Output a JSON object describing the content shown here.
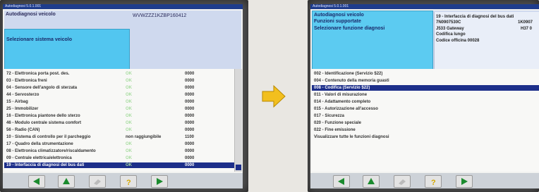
{
  "left_screen": {
    "window_title": "Autodiagnosi 5.0.1.001",
    "header_title": "Autodiagnosi veicolo",
    "vin": "WVWZZZ1KZBP160412",
    "prompt": "Selezionare sistema veicolo",
    "rows": [
      {
        "label": "72 - Elettronica porta post. des.",
        "status": "OK",
        "code": "0000"
      },
      {
        "label": "03 - Elettronica freni",
        "status": "OK",
        "code": "0000"
      },
      {
        "label": "04 - Sensore dell'angolo di sterzata",
        "status": "OK",
        "code": "0000"
      },
      {
        "label": "44 - Servosterzo",
        "status": "OK",
        "code": "0000"
      },
      {
        "label": "15 - Airbag",
        "status": "OK",
        "code": "0000"
      },
      {
        "label": "25 - Immobilizer",
        "status": "OK",
        "code": "0000"
      },
      {
        "label": "16 - Elettronica piantone dello sterzo",
        "status": "OK",
        "code": "0000"
      },
      {
        "label": "46 - Modulo centrale sistema comfort",
        "status": "OK",
        "code": "0000"
      },
      {
        "label": "56 - Radio (CAN)",
        "status": "OK",
        "code": "0000"
      },
      {
        "label": "10 - Sistema di controllo per il parcheggio",
        "status": "non raggiungibile",
        "code": "1100"
      },
      {
        "label": "17 - Quadro della strumentazione",
        "status": "OK",
        "code": "0000"
      },
      {
        "label": "08 - Elettronica climatizzatore/riscaldamento",
        "status": "OK",
        "code": "0000"
      },
      {
        "label": "09 - Centrale elettrica/elettronica",
        "status": "OK",
        "code": "0000"
      },
      {
        "label": "19 - Interfaccia di diagnosi del bus dati",
        "status": "OK",
        "code": "0000"
      }
    ],
    "selected_index": 13
  },
  "right_screen": {
    "window_title": "Autodiagnosi 5.0.1.001",
    "header_lines": [
      "Autodiagnosi veicolo",
      "Funzioni supportate",
      "Selezionare funzione diagnosi"
    ],
    "info_lines": [
      "19 - Interfaccia di diagnosi del bus dati",
      "7N0907530C",
      "J533 Gateway",
      "Codifica lungo",
      "Codice officina 00028"
    ],
    "info_right": [
      "1K0907",
      "H37 0"
    ],
    "rows": [
      "002 - Identificazione (Servizio $22)",
      "004 - Contenuto della memoria guasti",
      "008 - Codifica (Servizio $22)",
      "011 - Valori di misurazione",
      "014 - Adattamento completo",
      "015 - Autorizzazione all'accesso",
      "017 - Sicurezza",
      "020 - Funzione speciale",
      "022 - Fine emissione",
      "Visualizzare tutte le funzioni diagnosi"
    ],
    "selected_index": 2
  },
  "buttons": [
    "back-arrow",
    "up-arrow",
    "eraser",
    "help",
    "forward-arrow"
  ],
  "colors": {
    "highlight": "#1d2f8a",
    "accent_arrow": "#f2bf1e",
    "screen_header": "#52c6f0"
  }
}
